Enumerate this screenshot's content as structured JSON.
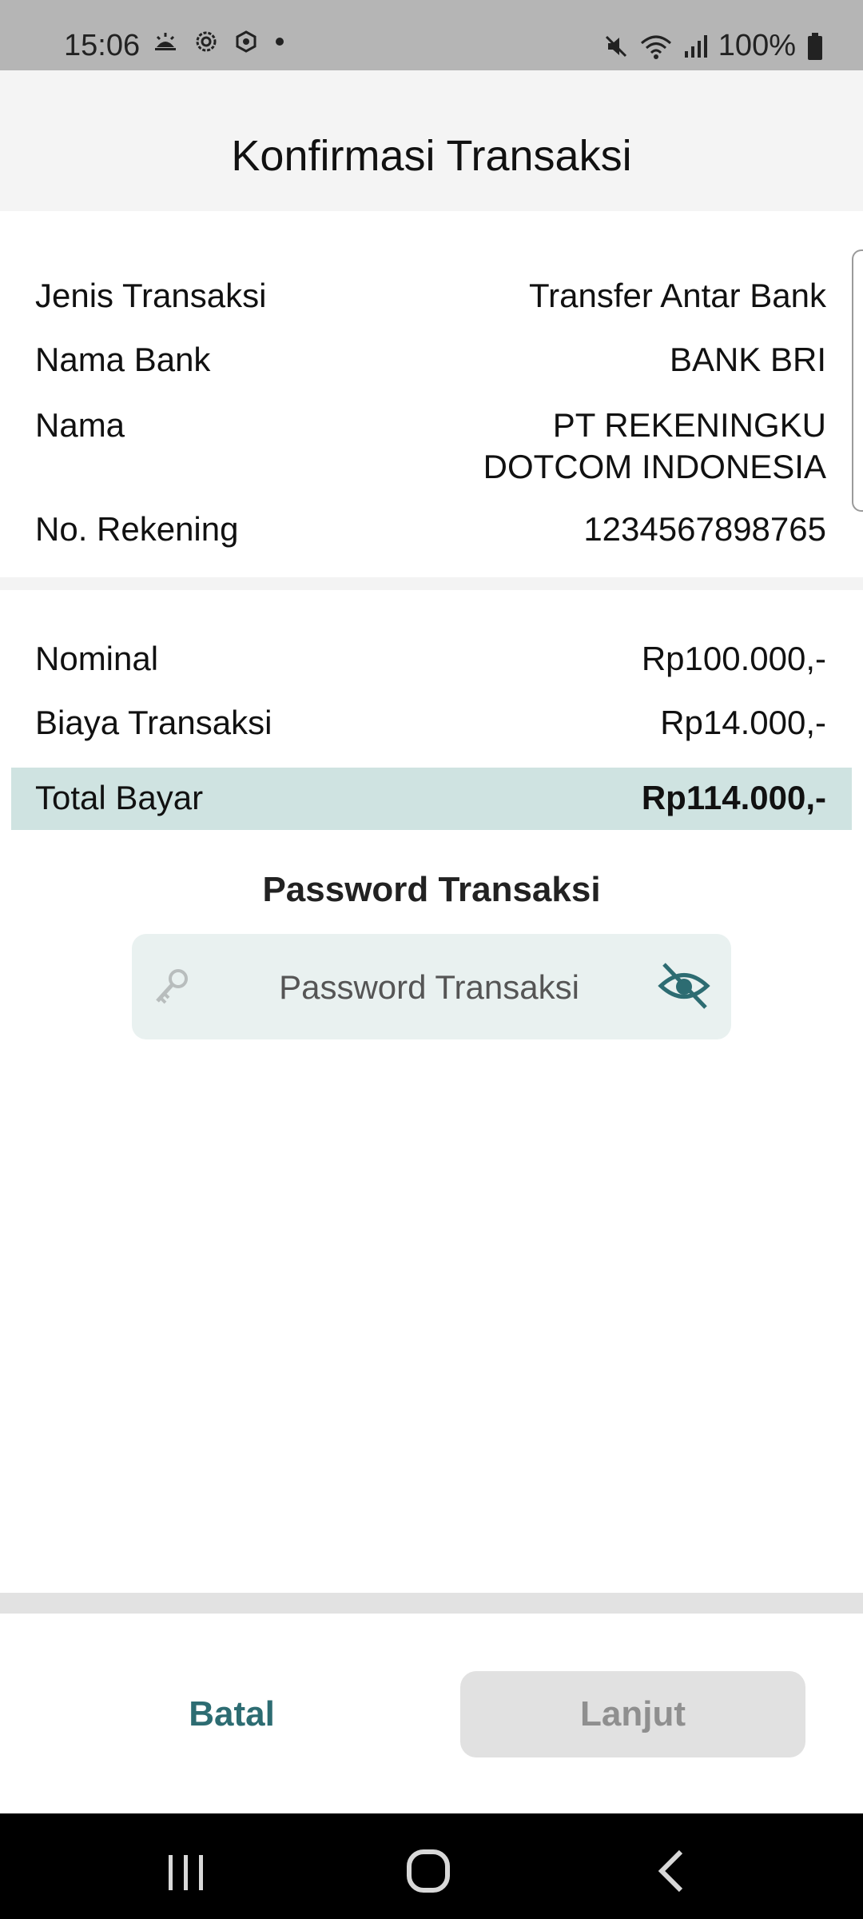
{
  "status_bar": {
    "time": "15:06",
    "battery": "100%",
    "left_icons": [
      "weather-icon",
      "settings-gear-icon",
      "vpn-icon",
      "dot-icon"
    ],
    "right_icons": [
      "mute-icon",
      "wifi-icon",
      "signal-icon",
      "battery-icon"
    ]
  },
  "header": {
    "title": "Konfirmasi Transaksi"
  },
  "details": {
    "jenis_label": "Jenis Transaksi",
    "jenis_value": "Transfer Antar Bank",
    "bank_label": "Nama Bank",
    "bank_value": "BANK BRI",
    "nama_label": "Nama",
    "nama_value_line1": "PT REKENINGKU",
    "nama_value_line2": "DOTCOM INDONESIA",
    "rekening_label": "No. Rekening",
    "rekening_value": "1234567898765"
  },
  "payment": {
    "nominal_label": "Nominal",
    "nominal_value": "Rp100.000,-",
    "biaya_label": "Biaya Transaksi",
    "biaya_value": "Rp14.000,-",
    "total_label": "Total Bayar",
    "total_value": "Rp114.000,-"
  },
  "password": {
    "title": "Password Transaksi",
    "placeholder": "Password Transaksi",
    "value": ""
  },
  "buttons": {
    "cancel_label": "Batal",
    "next_label": "Lanjut"
  },
  "colors": {
    "accent": "#2d6c72",
    "total_highlight": "#cfe3e1",
    "field_bg": "#e9f1f0",
    "disabled_button": "#e1e1e1"
  }
}
